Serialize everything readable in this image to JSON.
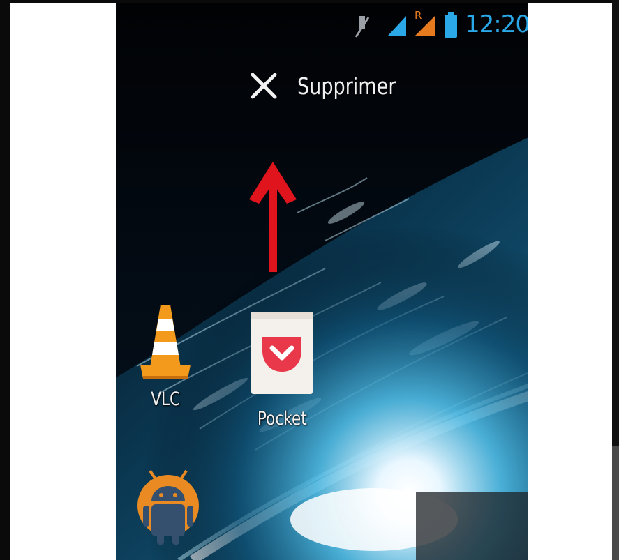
{
  "status_bar": {
    "time": "12:20",
    "icons": [
      "mute-icon",
      "signal-icon",
      "roaming-signal-icon",
      "battery-icon"
    ],
    "roaming_letter": "R"
  },
  "delete_zone": {
    "icon": "close-icon",
    "label": "Supprimer"
  },
  "drag_hint": {
    "icon": "arrow-up-icon",
    "color": "#e0141c"
  },
  "home_apps": [
    {
      "label": "VLC",
      "icon": "vlc-cone-icon"
    },
    {
      "label": "Pocket",
      "icon": "pocket-icon",
      "state": "dragging"
    },
    {
      "label": "",
      "icon": "android-icon"
    }
  ],
  "colors": {
    "clock": "#2aa8e8",
    "signal": "#2aa8e8",
    "roaming_signal": "#e57a1e",
    "pocket_red": "#e8384a",
    "vlc_orange": "#f39a1d",
    "android_orange": "#e98b22",
    "android_body": "#34506e"
  }
}
